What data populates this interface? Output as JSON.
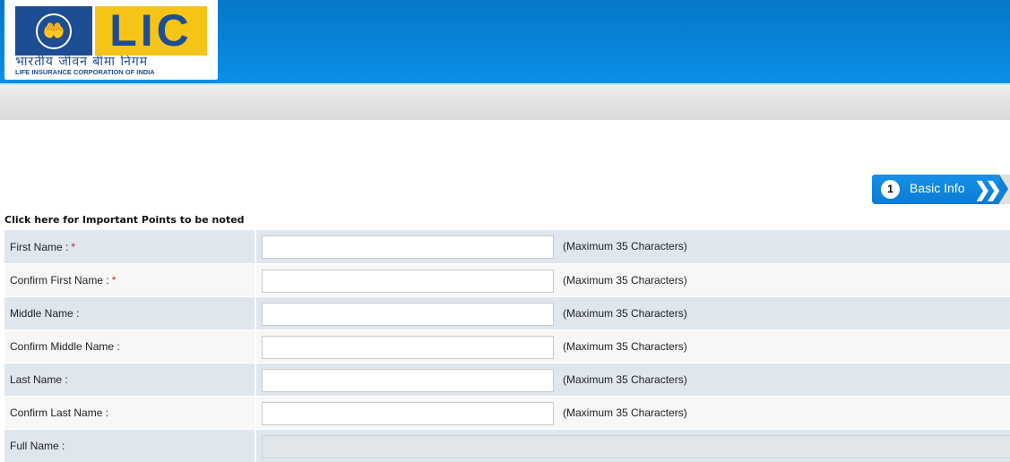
{
  "header": {
    "logo": {
      "brand": "LIC",
      "hindi_name": "भारतीय जीवन बीमा निगम",
      "english_name": "LIFE INSURANCE CORPORATION OF INDIA",
      "emblem_icon": "hands-lamp-icon"
    },
    "colors": {
      "header_blue": "#0a8fe8",
      "logo_navy": "#1d4d93",
      "logo_yellow": "#f6c416"
    }
  },
  "steps": [
    {
      "number": "1",
      "label": "Basic Info",
      "icon": "double-chevron-right-icon"
    }
  ],
  "notice_link": "Click here for Important Points to be noted",
  "form": {
    "rows": [
      {
        "label": "First Name :",
        "required": "*",
        "value": "",
        "hint": "(Maximum 35 Characters)"
      },
      {
        "label": "Confirm First Name :",
        "required": "*",
        "value": "",
        "hint": "(Maximum 35 Characters)"
      },
      {
        "label": "Middle Name :",
        "required": "",
        "value": "",
        "hint": "(Maximum 35 Characters)"
      },
      {
        "label": "Confirm Middle Name :",
        "required": "",
        "value": "",
        "hint": "(Maximum 35 Characters)"
      },
      {
        "label": "Last Name :",
        "required": "",
        "value": "",
        "hint": "(Maximum 35 Characters)"
      },
      {
        "label": "Confirm Last Name :",
        "required": "",
        "value": "",
        "hint": "(Maximum 35 Characters)"
      },
      {
        "label": "Full Name :",
        "required": "",
        "value": "",
        "hint": ""
      }
    ]
  }
}
